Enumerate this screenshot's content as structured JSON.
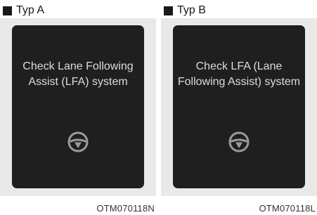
{
  "panels": [
    {
      "type_label": "Typ A",
      "message": "Check Lane Following\nAssist (LFA) system",
      "icon": "steering-wheel-icon",
      "code": "OTM070118N"
    },
    {
      "type_label": "Typ B",
      "message": "Check LFA (Lane\nFollowing Assist) system",
      "icon": "steering-wheel-icon",
      "code": "OTM070118L"
    }
  ],
  "colors": {
    "screen_bg": "#1f1f1f",
    "frame_bg": "#e9e9e9",
    "text_on_screen": "#dcdcdc"
  }
}
